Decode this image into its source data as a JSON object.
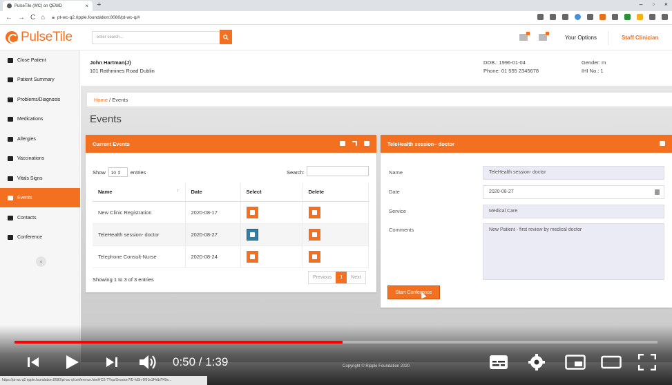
{
  "browser": {
    "tab_title": "PulseTile (WC) on QEWD",
    "url": "pt-wc-q2.ripple.foundation:8080/pt-wc-q/#",
    "status_url": "https://pt-wc-q2.ripple.foundation:8080/pt-wc-q/conference.html#CS-??/qs/Session?ID-fd5h-9f91e3f4db7f49e..."
  },
  "header": {
    "logo_text": "PulseTile",
    "search_placeholder": "enter search...",
    "your_options": "Your Options",
    "user_role": "Staff Clinician"
  },
  "sidebar": {
    "items": [
      {
        "label": "Close Patient",
        "icon": "users-icon"
      },
      {
        "label": "Patient Summary",
        "icon": "gauge-icon"
      },
      {
        "label": "Problems/Diagnosis",
        "icon": "document-icon"
      },
      {
        "label": "Medications",
        "icon": "pill-icon"
      },
      {
        "label": "Allergies",
        "icon": "bug-icon"
      },
      {
        "label": "Vaccinations",
        "icon": "syringe-icon"
      },
      {
        "label": "Vitals Signs",
        "icon": "heart-chart-icon"
      },
      {
        "label": "Events",
        "icon": "calendar-icon",
        "active": true
      },
      {
        "label": "Contacts",
        "icon": "phone-icon"
      },
      {
        "label": "Conference",
        "icon": "video-icon"
      }
    ],
    "collapse_glyph": "‹"
  },
  "patient": {
    "name": "John Hartman(J)",
    "address": "101 Rathmines Road Dublin",
    "dob": "DOB.: 1996-01-04",
    "phone": "Phone: 01 555 2345678",
    "gender": "Gender: m",
    "ihi": "IHI No.: 1"
  },
  "breadcrumb": {
    "home": "Home",
    "separator": "/",
    "current": "Events"
  },
  "page_title": "Events",
  "events_panel": {
    "title": "Current Events",
    "show_label": "Show",
    "page_length": "10",
    "entries_label": "entries",
    "search_label": "Search:",
    "columns": [
      "Name",
      "Date",
      "Select",
      "Delete"
    ],
    "rows": [
      {
        "name": "New Clinic Registration",
        "date": "2020-08-17"
      },
      {
        "name": "TeleHealth session- doctor",
        "date": "2020-08-27"
      },
      {
        "name": "Telephone Consult-Nurse",
        "date": "2020-08-24"
      }
    ],
    "info": "Showing 1 to 3 of 3 entries",
    "pager": {
      "previous": "Previous",
      "current": "1",
      "next": "Next"
    }
  },
  "detail_panel": {
    "title": "TeleHealth session– doctor",
    "fields": [
      {
        "label": "Name",
        "value": "TeleHealth session- doctor"
      },
      {
        "label": "Date",
        "value": "2020-08-27"
      },
      {
        "label": "Service",
        "value": "Medical Care"
      },
      {
        "label": "Comments",
        "value": "New Patient - first review by medical doctor"
      }
    ],
    "start_button": "Start Conference"
  },
  "video": {
    "current_time": "0:50",
    "duration": "1:39",
    "time_display": "0:50 / 1:39",
    "progress_fraction": 0.51,
    "copyright": "Copyright © Ripple Foundation 2020"
  },
  "colors": {
    "accent": "#f37021",
    "select_active": "#2e80a8",
    "progress": "#ff0000"
  }
}
